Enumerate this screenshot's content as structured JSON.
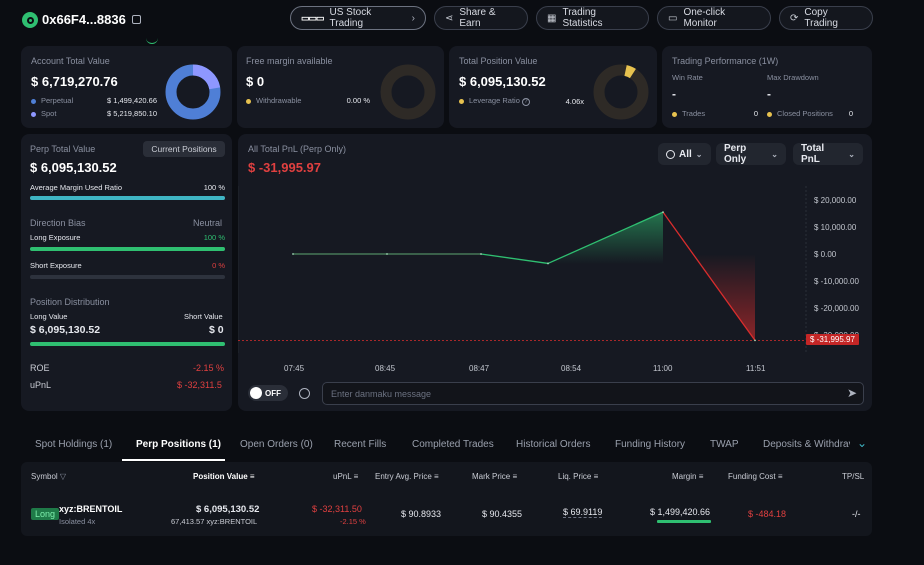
{
  "header": {
    "address": "0x66F4...8836",
    "us_stock_trading": "US Stock Trading",
    "share_earn": "Share & Earn",
    "trading_statistics": "Trading Statistics",
    "one_click_monitor": "One-click Monitor",
    "copy_trading": "Copy Trading"
  },
  "account": {
    "title": "Account Total Value",
    "value": "$ 6,719,270.76",
    "perpetual_label": "Perpetual",
    "perpetual_value": "$ 1,499,420.66",
    "spot_label": "Spot",
    "spot_value": "$ 5,219,850.10",
    "perp_color": "#4f7fd6",
    "spot_color": "#8e97ff"
  },
  "free_margin": {
    "title": "Free margin available",
    "value": "$ 0",
    "withdrawable_label": "Withdrawable",
    "withdrawable_value": "0.00 %"
  },
  "position_value": {
    "title": "Total Position Value",
    "value": "$ 6,095,130.52",
    "leverage_label": "Leverage Ratio",
    "leverage_value": "4.06x"
  },
  "performance": {
    "title": "Trading Performance (1W)",
    "win_rate_label": "Win Rate",
    "win_rate_value": "-",
    "max_drawdown_label": "Max Drawdown",
    "max_drawdown_value": "-",
    "trades_label": "Trades",
    "trades_value": "0",
    "closed_label": "Closed Positions",
    "closed_value": "0"
  },
  "perp_panel": {
    "title": "Perp Total Value",
    "current_positions": "Current Positions",
    "value": "$ 6,095,130.52",
    "avg_margin_label": "Average Margin Used Ratio",
    "avg_margin_value": "100 %",
    "avg_margin_fraction": 1.0,
    "direction_bias_label": "Direction Bias",
    "direction_bias_value": "Neutral",
    "long_exposure_label": "Long Exposure",
    "long_exposure_value": "100 %",
    "long_exposure_fraction": 1.0,
    "short_exposure_label": "Short Exposure",
    "short_exposure_value": "0 %",
    "short_exposure_fraction": 0.0,
    "distribution_label": "Position Distribution",
    "long_value_label": "Long Value",
    "short_value_label": "Short Value",
    "long_value": "$ 6,095,130.52",
    "short_value": "$ 0",
    "roe_label": "ROE",
    "roe_value": "-2.15 %",
    "upnl_label": "uPnL",
    "upnl_value": "$ -32,311.5"
  },
  "pnl_chart": {
    "title": "All Total PnL (Perp Only)",
    "value": "$ -31,995.97",
    "filter_all": "All",
    "filter_perp": "Perp Only",
    "filter_total": "Total PnL",
    "current_label": "$ -31,995.97",
    "toggle_label": "OFF",
    "danmaku_placeholder": "Enter danmaku message"
  },
  "chart_data": {
    "type": "area",
    "title": "All Total PnL (Perp Only)",
    "x_ticks": [
      "07:45",
      "08:45",
      "08:47",
      "08:54",
      "11:00",
      "11:51"
    ],
    "y_ticks": [
      "$ 20,000.00",
      "$ 10,000.00",
      "$ 0.00",
      "$ -10,000.00",
      "$ -20,000.00",
      "$ -30,000.00"
    ],
    "ylim": [
      -32000,
      22000
    ],
    "series": [
      {
        "points": [
          {
            "x": "07:45",
            "y": 0
          },
          {
            "x": "08:45",
            "y": 0
          },
          {
            "x": "08:47",
            "y": 0
          },
          {
            "x": "08:54",
            "y": -3500
          },
          {
            "x": "11:00",
            "y": 15500
          },
          {
            "x": "11:51",
            "y": -31995.97
          }
        ]
      }
    ],
    "colors": {
      "up": "#2fbf71",
      "down": "#d92d2d"
    }
  },
  "tabs": [
    "Spot Holdings (1)",
    "Perp Positions (1)",
    "Open Orders (0)",
    "Recent Fills",
    "Completed Trades",
    "Historical Orders",
    "Funding History",
    "TWAP",
    "Deposits & Withdrav"
  ],
  "table": {
    "headers": {
      "symbol": "Symbol",
      "position_value": "Position Value",
      "upnl": "uPnL",
      "entry": "Entry Avg. Price",
      "mark": "Mark Price",
      "liq": "Liq. Price",
      "margin": "Margin",
      "funding": "Funding Cost",
      "tpsl": "TP/SL"
    },
    "row": {
      "side": "Long",
      "symbol": "xyz:BRENTOIL",
      "mode": "Isolated 4x",
      "position_value": "$ 6,095,130.52",
      "position_size": "67,413.57 xyz:BRENTOIL",
      "upnl": "$ -32,311.50",
      "upnl_pct": "-2.15 %",
      "entry": "$ 90.8933",
      "mark": "$ 90.4355",
      "liq": "$ 69.9119",
      "margin": "$ 1,499,420.66",
      "funding": "$ -484.18",
      "tpsl": "-/-"
    }
  }
}
